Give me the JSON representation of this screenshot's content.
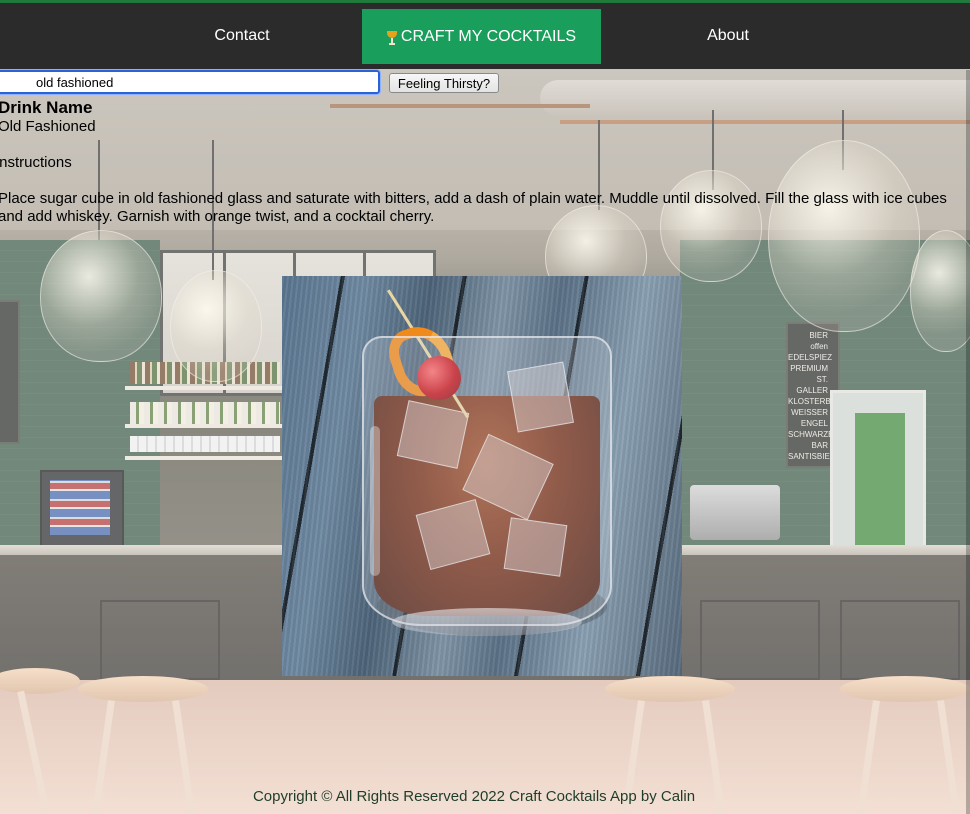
{
  "nav": {
    "contact_label": "Contact",
    "brand_label": "CRAFT MY COCKTAILS",
    "brand_icon": "cocktail-glass-icon",
    "about_label": "About",
    "bar_color": "#2b2b2b",
    "brand_color": "#1a9e5c"
  },
  "search": {
    "value": "old fashioned",
    "button_label": "Feeling Thirsty?"
  },
  "drink": {
    "heading": "Drink Name",
    "name": "Old Fashioned",
    "instructions_label": "Instructions",
    "instructions": "Place sugar cube in old fashioned glass and saturate with bitters, add a dash of plain water. Muddle until dissolved. Fill the glass with ice cubes and add whiskey. Garnish with orange twist, and a cocktail cherry."
  },
  "footer": {
    "text": "Copyright © All Rights Reserved 2022 Craft Cocktails App by Calin"
  }
}
